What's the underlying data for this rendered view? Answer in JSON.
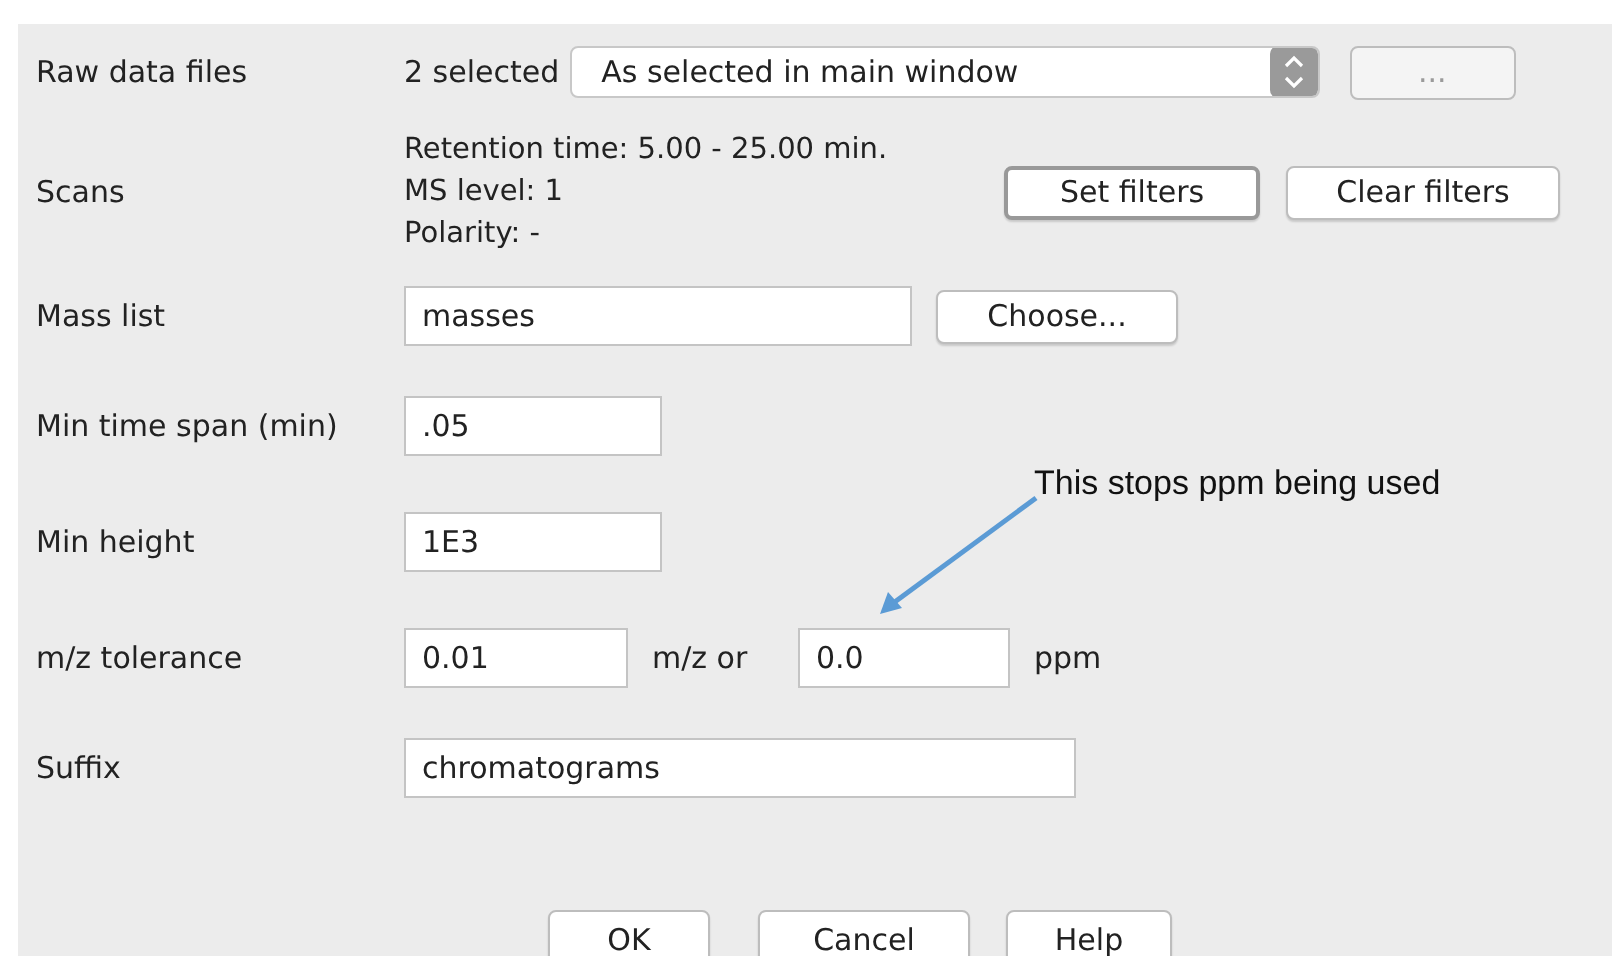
{
  "raw_data_files": {
    "label": "Raw data files",
    "count": "2 selected",
    "dropdown": "As selected in main window",
    "browse_button": {
      "label": "...",
      "disabled": true
    }
  },
  "scans": {
    "label": "Scans",
    "lines": [
      "Retention time: 5.00 - 25.00 min.",
      "MS level: 1",
      "Polarity: -"
    ],
    "buttons": [
      "Set filters",
      "Clear filters"
    ]
  },
  "mass_list": {
    "label": "Mass list",
    "value": "masses",
    "button": "Choose..."
  },
  "min_time_span": {
    "label": "Min time span (min)",
    "value": ".05"
  },
  "min_height": {
    "label": "Min height",
    "value": "1E3"
  },
  "mz_tolerance": {
    "label": "m/z tolerance",
    "mz_value": "0.01",
    "mz_unit": "m/z  or",
    "ppm_value": "0.0",
    "ppm_unit": "ppm"
  },
  "suffix": {
    "label": "Suffix",
    "value": "chromatograms"
  },
  "buttons": [
    "OK",
    "Cancel",
    "Help"
  ],
  "annotation": {
    "text": "This stops ppm being used"
  }
}
